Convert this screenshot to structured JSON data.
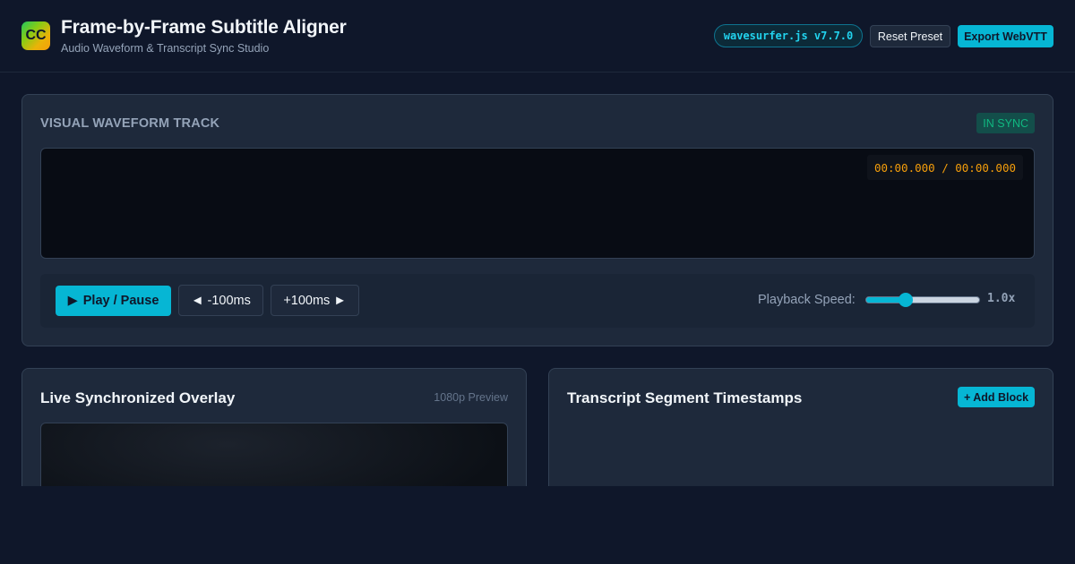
{
  "header": {
    "logo_text": "CC",
    "title": "Frame-by-Frame Subtitle Aligner",
    "subtitle": "Audio Waveform & Transcript Sync Studio",
    "version_badge": "wavesurfer.js v7.7.0",
    "reset_label": "Reset Preset",
    "export_label": "Export WebVTT"
  },
  "waveform": {
    "heading": "VISUAL WAVEFORM TRACK",
    "status": "IN SYNC",
    "time_readout": "00:00.000 / 00:00.000"
  },
  "controls": {
    "play_icon": "▶",
    "play_label": "Play / Pause",
    "back_icon": "◄",
    "back_label": "-100ms",
    "forward_label": "+100ms",
    "forward_icon": "►",
    "speed_label": "Playback Speed:",
    "speed_value": "1.0x",
    "speed_fraction": 0.35
  },
  "overlay_panel": {
    "title": "Live Synchronized Overlay",
    "preview_label": "1080p Preview"
  },
  "transcript_panel": {
    "title": "Transcript Segment Timestamps",
    "add_label": "+ Add Block"
  },
  "colors": {
    "accent": "#06b6d4",
    "background": "#0f172a",
    "sync_status": "#10b981",
    "time_readout": "#f59e0b"
  }
}
